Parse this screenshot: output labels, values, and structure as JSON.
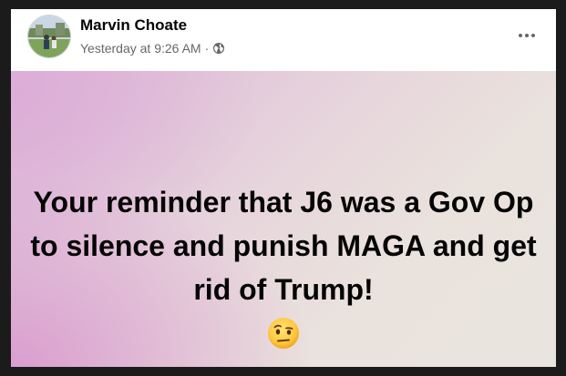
{
  "post": {
    "author": "Marvin Choate",
    "timestamp": "Yesterday at 9:26 AM",
    "separator": "·",
    "privacy_icon": "globe-icon",
    "more_icon": "more-options-icon",
    "text": "Your reminder that J6 was a Gov Op to silence and punish MAGA and get rid of Trump!",
    "emoji": "face-with-raised-eyebrow-emoji",
    "background_colors": [
      "#dcb4d8",
      "#e7d6dc",
      "#e9e4de"
    ]
  }
}
